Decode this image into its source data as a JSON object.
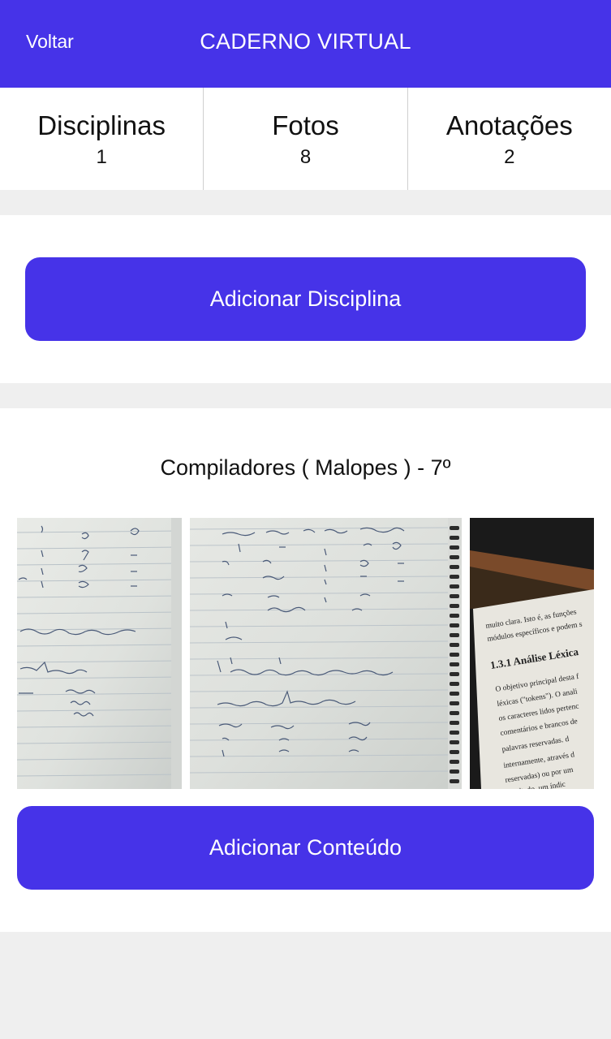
{
  "header": {
    "back_label": "Voltar",
    "title": "CADERNO VIRTUAL",
    "background_color": "#4633e8"
  },
  "stats": [
    {
      "label": "Disciplinas",
      "count": "1"
    },
    {
      "label": "Fotos",
      "count": "8"
    },
    {
      "label": "Anotações",
      "count": "2"
    }
  ],
  "actions": {
    "add_discipline_label": "Adicionar Disciplina",
    "add_content_label": "Adicionar Conteúdo"
  },
  "subject": {
    "title": "Compiladores ( Malopes ) - 7º",
    "photos": [
      {
        "kind": "handwritten-notebook-page"
      },
      {
        "kind": "handwritten-notebook-page-spiral"
      },
      {
        "kind": "printed-book-page"
      }
    ],
    "book_page_text": {
      "line1": "muito clara. Isto é, as funções",
      "line2": "módulos específicos e podem s",
      "heading": "1.3.1  Análise Léxica",
      "body1": "O objetivo principal desta f",
      "body2": "léxicas (\"tokens\"). O anali",
      "body3": "os caracteres lidos pertenc",
      "body4": "comentários e brancos de",
      "body5": "palavras reservadas. d",
      "body6": "internamente, através d",
      "body7": "reservadas) ou por um",
      "body8": "resultado, um índic"
    }
  },
  "colors": {
    "accent": "#4633e8",
    "page_background": "#efefef",
    "card_background": "#ffffff"
  }
}
